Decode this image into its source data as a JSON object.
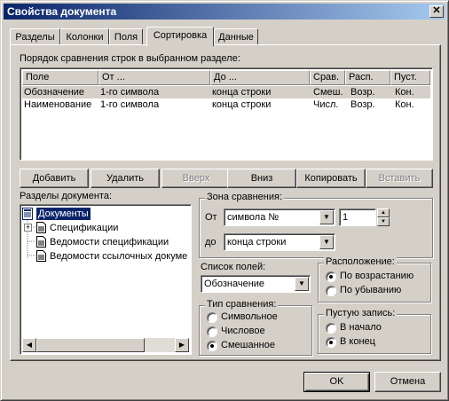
{
  "window": {
    "title": "Свойства документа",
    "close_glyph": "✕"
  },
  "tabs": [
    {
      "label": "Разделы"
    },
    {
      "label": "Колонки"
    },
    {
      "label": "Поля"
    },
    {
      "label": "Сортировка",
      "active": true
    },
    {
      "label": "Данные"
    }
  ],
  "sort_order": {
    "caption": "Порядок сравнения строк в выбранном разделе:",
    "columns": [
      "Поле",
      "От ...",
      "До ...",
      "Срав.",
      "Расп.",
      "Пуст."
    ],
    "rows": [
      {
        "field": "Обозначение",
        "from": "1-го символа",
        "to": "конца строки",
        "cmp": "Смеш.",
        "pos": "Возр.",
        "empty": "Кон.",
        "selected": true
      },
      {
        "field": "Наименование",
        "from": "1-го символа",
        "to": "конца строки",
        "cmp": "Числ.",
        "pos": "Возр.",
        "empty": "Кон.",
        "selected": false
      }
    ]
  },
  "buttons": {
    "add": "Добавить",
    "delete": "Удалить",
    "up": "Вверх",
    "down": "Вниз",
    "copy": "Копировать",
    "paste": "Вставить"
  },
  "sections": {
    "caption": "Разделы документа:",
    "root": "Документы",
    "children": [
      "Спецификации",
      "Ведомости спецификации",
      "Ведомости ссылочных докуме"
    ]
  },
  "compare_zone": {
    "title": "Зона сравнения:",
    "from_label": "От",
    "from_value": "символа №",
    "from_number": "1",
    "to_label": "до",
    "to_value": "конца строки"
  },
  "field_list": {
    "label": "Список полей:",
    "value": "Обозначение"
  },
  "order": {
    "title": "Расположение:",
    "options": [
      {
        "label": "По возрастанию",
        "checked": true
      },
      {
        "label": "По убыванию",
        "checked": false
      }
    ]
  },
  "compare_type": {
    "title": "Тип сравнения:",
    "options": [
      {
        "label": "Символьное",
        "checked": false
      },
      {
        "label": "Числовое",
        "checked": false
      },
      {
        "label": "Смешанное",
        "checked": true
      }
    ]
  },
  "empty_record": {
    "title": "Пустую запись:",
    "options": [
      {
        "label": "В начало",
        "checked": false
      },
      {
        "label": "В конец",
        "checked": true
      }
    ]
  },
  "footer": {
    "ok": "OK",
    "cancel": "Отмена"
  },
  "colors": {
    "title_start": "#0a246a",
    "title_end": "#a6caf0",
    "face": "#d4d0c8",
    "selection": "#0a246a"
  }
}
